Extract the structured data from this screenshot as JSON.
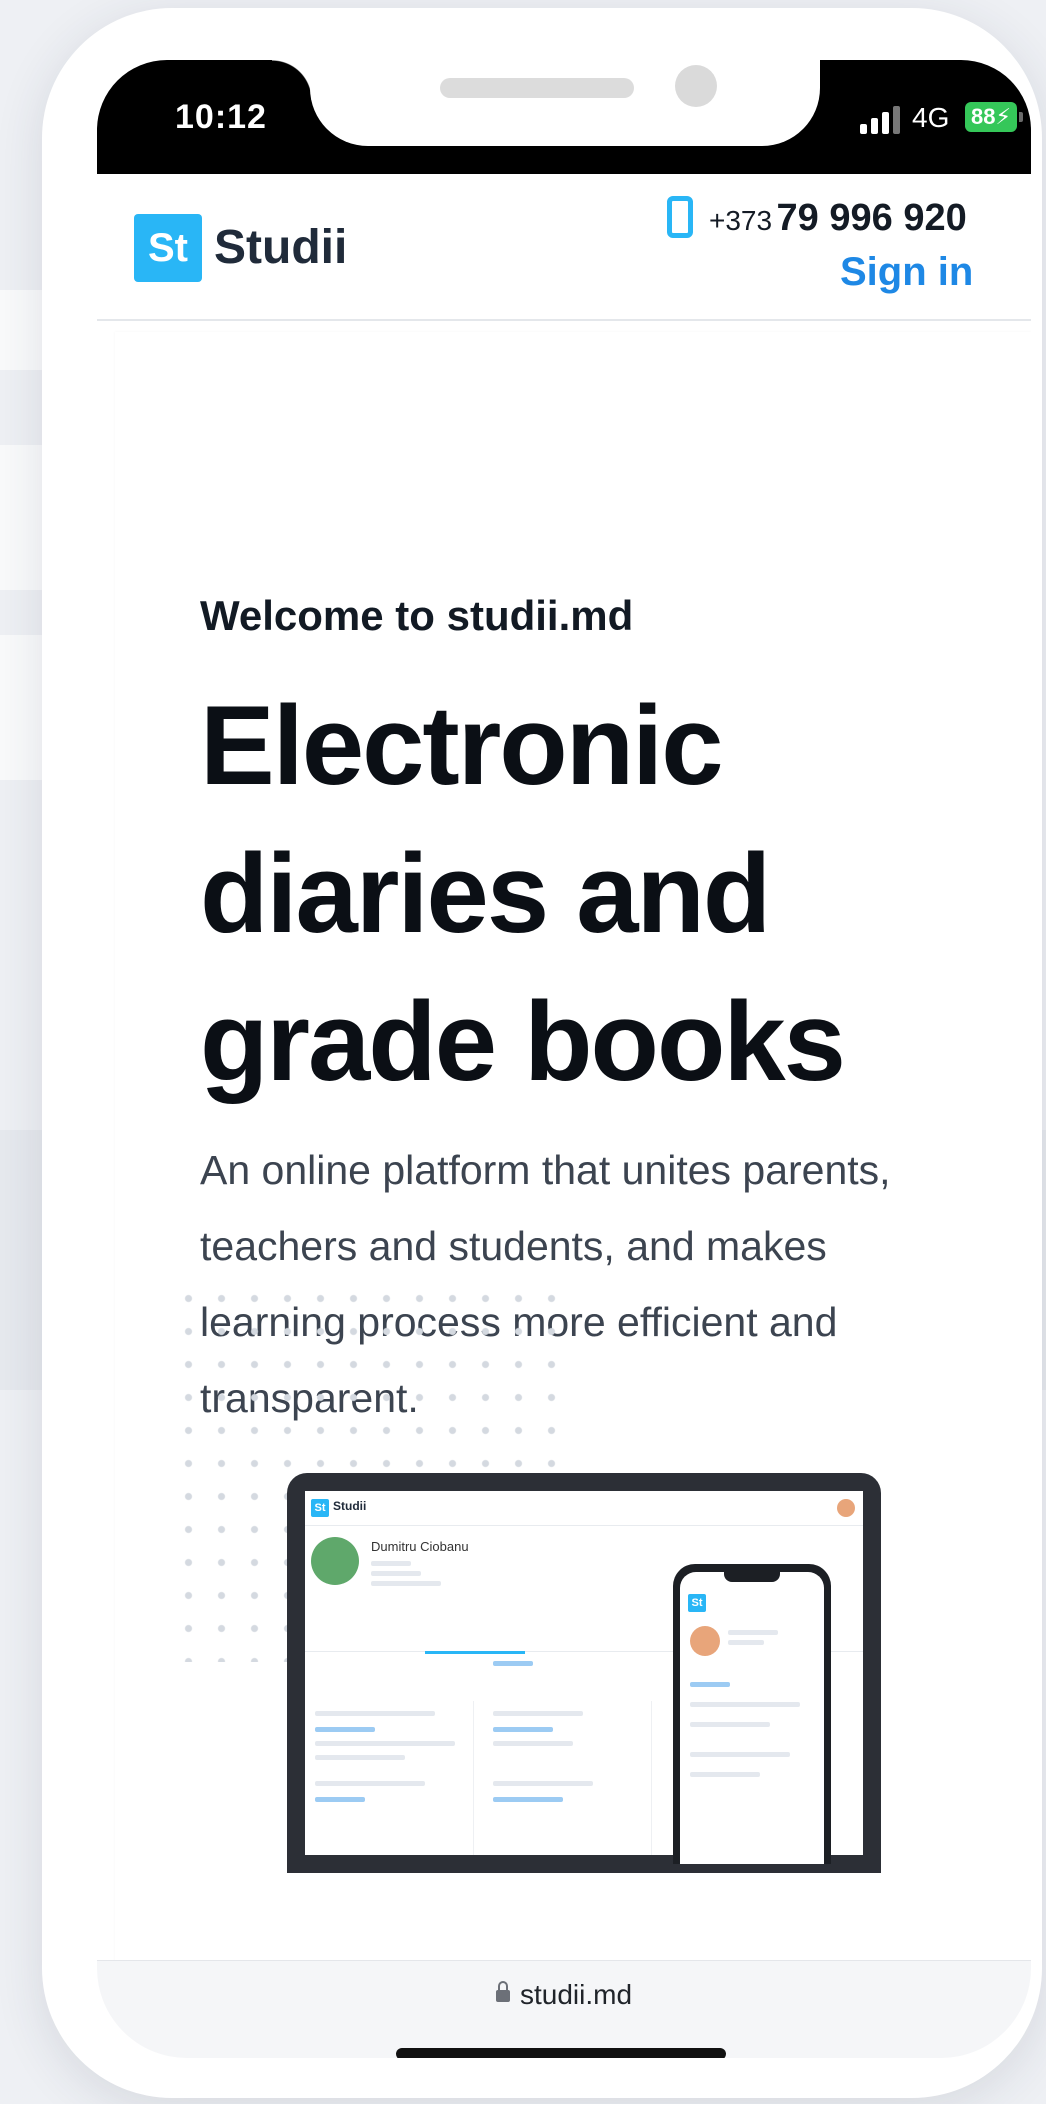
{
  "status_bar": {
    "time": "10:12",
    "network": "4G",
    "battery": "88"
  },
  "header": {
    "logo_mark": "St",
    "logo_text": "Studii",
    "phone_prefix": "+373",
    "phone_number": "79 996 920",
    "signin_label": "Sign in",
    "accent_color": "#29b6f6",
    "link_color": "#1e88e5"
  },
  "hero": {
    "welcome": "Welcome to studii.md",
    "headline": "Electronic diaries and grade books",
    "lead": "An online platform that unites parents, teachers and students, and makes learning process more efficient and transparent."
  },
  "preview": {
    "logo_text": "Studii",
    "user_name": "Dumitru Ciobanu"
  },
  "browser": {
    "url": "studii.md"
  }
}
